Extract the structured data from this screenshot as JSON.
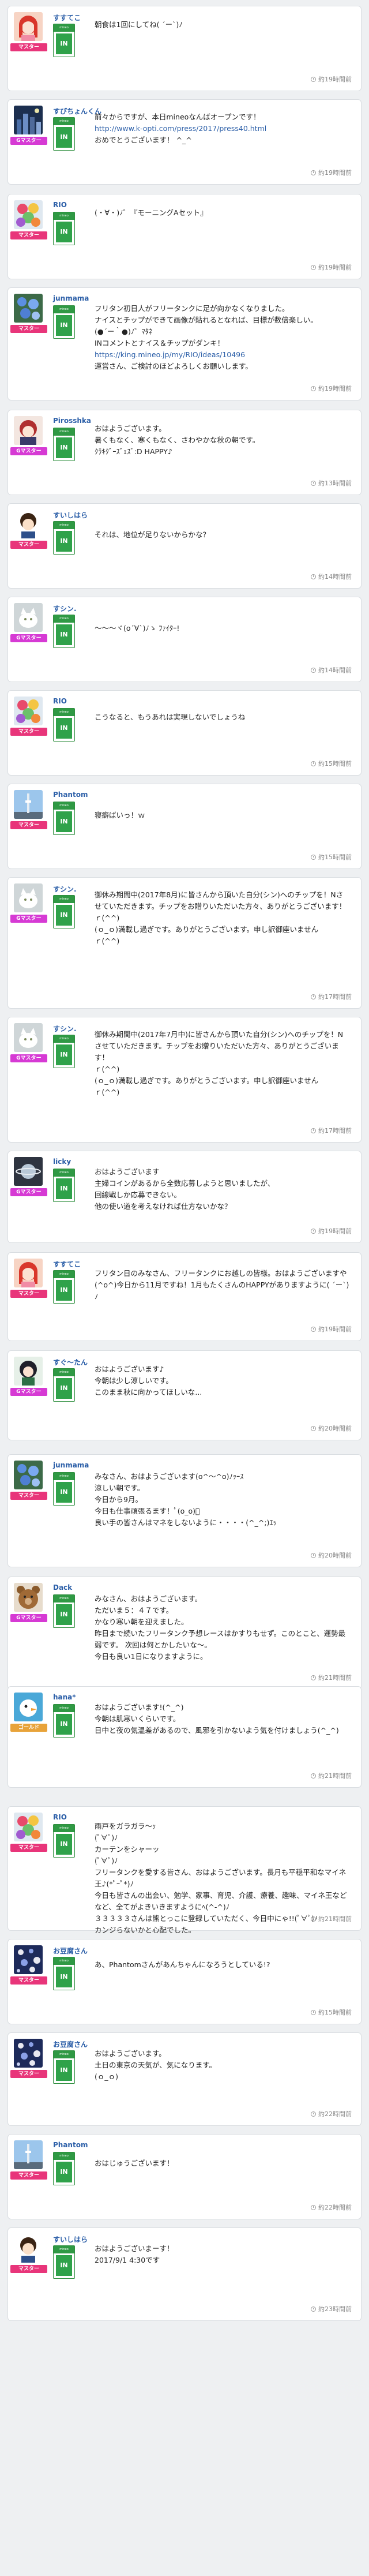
{
  "colors": {
    "master": "#e8357a",
    "goldstar": "#d63ad4",
    "silverstar": "#e8a33a",
    "accent": "#2c5fa8",
    "badge": "#2f9944"
  },
  "badge": {
    "top": "mineo",
    "in": "IN"
  },
  "posts": [
    {
      "user": "すすてこ",
      "rank": "マスター",
      "rank_color": "#e8357a",
      "avatar": "red-hair-girl",
      "lines": [
        "朝食は1回にしてね( ´ー`)ﾉ"
      ],
      "time": "約19時間前"
    },
    {
      "user": "すぴちょんくん",
      "rank": "Gマスター",
      "rank_color": "#d63ad4",
      "avatar": "night-city",
      "lines": [
        "前々からですが、本日mineoなんばオープンです！",
        "http://www.k-opti.com/press/2017/press40.html",
        "おめでとうございます！ ^_^"
      ],
      "link_line": 1,
      "time": "約19時間前"
    },
    {
      "user": "RIO",
      "rank": "マスター",
      "rank_color": "#e8357a",
      "avatar": "flower-bouquet",
      "lines": [
        "(・∀・)ﾉ゛『モーニングAセット』"
      ],
      "time": "約19時間前"
    },
    {
      "user": "junmama",
      "rank": "マスター",
      "rank_color": "#e8357a",
      "avatar": "blue-flowers",
      "lines": [
        "フリタン初日人がフリータンクに足が向かなくなりました。",
        "ナイスとチップができて画像が貼れるとなれば、目標が数倍楽しい。",
        "(●´ー｀●)ﾉ゛ﾏﾀﾈ",
        "INコメントとナイス＆チップがダンキ！",
        "https://king.mineo.jp/my/RIO/ideas/10496",
        "運営さん、ご検討のほどよろしくお願いします。"
      ],
      "link_line": 4,
      "time": "約19時間前"
    },
    {
      "user": "Pirosshka",
      "rank": "Gマスター",
      "rank_color": "#d63ad4",
      "avatar": "anime-girl",
      "lines": [
        "おはようございます。",
        "暑くもなく、寒くもなく、さわやかな秋の朝です。",
        "ｸﾗｷｸﾞｰｽﾞｪｽﾞ:D HAPPY♪"
      ],
      "time": "約13時間前"
    },
    {
      "user": "すいしはら",
      "rank": "マスター",
      "rank_color": "#e8357a",
      "avatar": "dark-hair-boy",
      "lines": [
        "それは、地位が足りないからかな？"
      ],
      "time": "約14時間前"
    },
    {
      "user": "すシン.",
      "rank": "Gマスター",
      "rank_color": "#d63ad4",
      "avatar": "white-cat",
      "lines": [
        "～～～ヾ(o´∀`)ﾉゝ ﾌｧｲﾀｰ!"
      ],
      "time": "約14時間前"
    },
    {
      "user": "RIO",
      "rank": "マスター",
      "rank_color": "#e8357a",
      "avatar": "flower-bouquet",
      "lines": [
        "こうなると、もうあれは実現しないでしょうね"
      ],
      "time": "約15時間前"
    },
    {
      "user": "Phantom",
      "rank": "マスター",
      "rank_color": "#e8357a",
      "avatar": "sky-tower",
      "lines": [
        "寝癖ばいっ！ｗ"
      ],
      "time": "約15時間前"
    },
    {
      "user": "すシン.",
      "rank": "Gマスター",
      "rank_color": "#d63ad4",
      "avatar": "white-cat",
      "lines": [
        "御休み期間中(2017年8月)に皆さんから頂いた自分(シン)へのチップを！Nさせていただきます。チップをお贈りいただいた方々、ありがとうございます！",
        "ｒ(^^)",
        "(ｏ_ｏ)満載し過ぎです。ありがとうございます。申し訳御座いません",
        "ｒ(^^)"
      ],
      "time": "約17時間前"
    },
    {
      "user": "すシン.",
      "rank": "Gマスター",
      "rank_color": "#d63ad4",
      "avatar": "white-cat",
      "lines": [
        "御休み期間中(2017年7月中)に皆さんから頂いた自分(シン)へのチップを！Nさせていただきます。チップをお贈りいただいた方々、ありがとうございます！",
        "ｒ(^^)",
        "(ｏ_ｏ)満載し過ぎです。ありがとうございます。申し訳御座いません",
        "ｒ(^^)"
      ],
      "time": "約17時間前"
    },
    {
      "user": "licky",
      "rank": "Gマスター",
      "rank_color": "#d63ad4",
      "avatar": "planet",
      "lines": [
        "おはようございます",
        "主婦コインがあるから全数応募しようと思いましたが、",
        "回線戦しか応募できない。",
        "他の使い道を考えなければ仕方ないかな？"
      ],
      "time": "約19時間前"
    },
    {
      "user": "すすてこ",
      "rank": "マスター",
      "rank_color": "#e8357a",
      "avatar": "red-hair-girl",
      "lines": [
        "フリタン日のみなさん、フリータンクにお越しの皆様。おはようございますや(^o^)今日から11月ですね！1月もたくさんのHAPPYがありますように( ´ー`)ﾉ"
      ],
      "time": "約19時間前"
    },
    {
      "user": "すぐ～たん",
      "rank": "Gマスター",
      "rank_color": "#d63ad4",
      "avatar": "ninja-girl",
      "lines": [
        "おはようございます♪",
        "今朝は少し涼しいです。",
        "このまま秋に向かってほしいな..."
      ],
      "time": "約20時間前"
    },
    {
      "user": "junmama",
      "rank": "マスター",
      "rank_color": "#e8357a",
      "avatar": "blue-flowers",
      "lines": [
        "みなさん、おはようございます(o^～^o)ﾉｯｰｽ",
        "涼しい朝です。",
        "今日から9月。",
        "今日も仕事頑張るます！ﾟ(o_o)ﾟ",
        "良い手の皆さんはマネをしないように・・・・(^_^;)ｴｯ"
      ],
      "time": "約20時間前"
    },
    {
      "user": "Dack",
      "rank": "Gマスター",
      "rank_color": "#d63ad4",
      "avatar": "teddy-bear",
      "lines": [
        "みなさん、おはようございます。",
        "ただいま５：４７です。",
        "かなり寒い朝を迎えました。",
        "昨日まで続いたフリータンク予想レースはかすりもせず。このとこと、運勢最弱です。 次回は何とかしたいな～。",
        "今日も良い1日になりますように。"
      ],
      "time": "約21時間前"
    },
    {
      "user": "hana*",
      "rank": "ゴールド",
      "rank_color": "#e8a33a",
      "avatar": "cartoon-bird",
      "lines": [
        "おはようございます!(^_^)",
        "今朝は肌寒いくらいです。",
        "日中と夜の気温差があるので、風邪を引かないよう気を付けましょう(^_^)"
      ],
      "time": "約21時間前"
    },
    {
      "user": "RIO",
      "rank": "マスター",
      "rank_color": "#e8357a",
      "avatar": "flower-bouquet",
      "lines": [
        "雨戸をガラガラ～ｯ",
        "(ﾟ∀ﾟ)ﾉ",
        "カーテンをシャーッ",
        "(ﾟ∀ﾟ)ﾉ",
        "フリータンクを愛する皆さん、おはようございます。長月も平穏平和なマイネ王♪(*ﾟｰﾟ*)ﾉ",
        "今日も皆さんの出会い、勉学、家事、育児、介護、療養、趣味、マイネ王などなど、全てがよきいきますようにﾍ(^-^)ﾉ",
        "３３３３３さんは熊とっこに登録していただく、今日中にゃ!!(ﾟ∀ﾟ)ﾉ",
        "カンジらないかと心配でした。"
      ],
      "time": "約21時間前"
    },
    {
      "user": "お豆腐さん",
      "rank": "マスター",
      "rank_color": "#e8357a",
      "avatar": "pattern-dots",
      "lines": [
        "あ、Phantomさんがあんちゃんになろうとしている!?"
      ],
      "time": "約15時間前"
    },
    {
      "user": "お豆腐さん",
      "rank": "マスター",
      "rank_color": "#e8357a",
      "avatar": "pattern-dots",
      "lines": [
        "おはようございます。",
        "土日の東京の天気が、気になります。",
        "(ｏ_ｏ)"
      ],
      "time": "約22時間前"
    },
    {
      "user": "Phantom",
      "rank": "マスター",
      "rank_color": "#e8357a",
      "avatar": "sky-tower",
      "lines": [
        "おはじゅうございます！"
      ],
      "time": "約22時間前"
    },
    {
      "user": "すいしはら",
      "rank": "マスター",
      "rank_color": "#e8357a",
      "avatar": "dark-hair-boy",
      "lines": [
        "おはようございまーす！",
        "2017/9/1 4:30です"
      ],
      "time": "約23時間前"
    }
  ]
}
